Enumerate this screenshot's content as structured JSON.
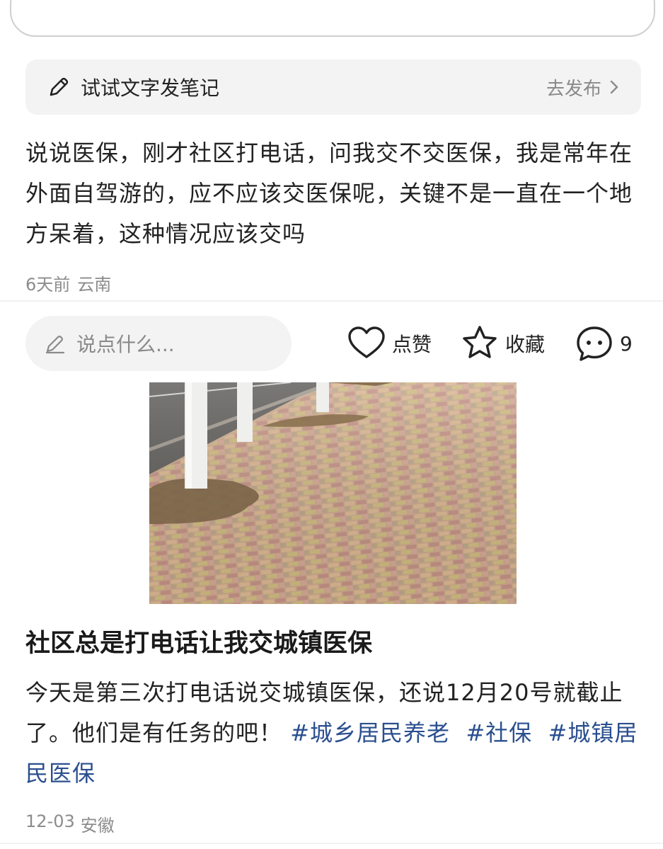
{
  "note_bar": {
    "label": "试试文字发笔记",
    "publish": "去发布"
  },
  "post1": {
    "text": "说说医保，刚才社区打电话，问我交不交医保，我是常年在外面自驾游的，应不应该交医保呢，关键不是一直在一个地方呆着，这种情况应该交吗",
    "time": "6天前",
    "location": "云南"
  },
  "actions": {
    "comment_placeholder": "说点什么...",
    "like_label": "点赞",
    "favorite_label": "收藏",
    "comment_count": "9"
  },
  "post2": {
    "title": "社区总是打电话让我交城镇医保",
    "text": "今天是第三次打电话说交城镇医保，还说12月20号就截止了。他们是有任务的吧！",
    "tags": [
      "#城乡居民养老",
      "#社保",
      "#城镇居民医保"
    ],
    "date": "12-03",
    "location": "安徽"
  },
  "icons": {
    "note_bar": "pencil-icon",
    "publish": "chevron-right-icon",
    "comment_box": "pencil-icon",
    "like": "heart-icon",
    "favorite": "star-icon",
    "comment": "comment-bubble-icon"
  },
  "colors": {
    "tag": "#2a4f8f",
    "meta": "#8c8c8c",
    "input_bg": "#f3f3f3"
  }
}
